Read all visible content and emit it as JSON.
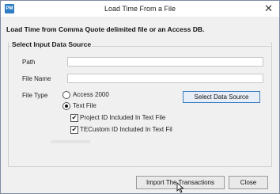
{
  "window": {
    "title": "Load Time From a File",
    "icon_text": "PM",
    "close_glyph": "✕"
  },
  "dialog": {
    "heading": "Load Time from Comma Quote delimited file or an Access DB.",
    "group_title": "Select Input Data Source",
    "path_label": "Path",
    "path_value": "",
    "file_name_label": "File Name",
    "file_name_value": "",
    "file_type_label": "File Type",
    "file_types": [
      {
        "label": "Access 2000",
        "selected": false
      },
      {
        "label": "Text File",
        "selected": true
      }
    ],
    "options": [
      {
        "label": "Project ID Included In Text File",
        "checked": true
      },
      {
        "label": "TECustom ID Included In Text Fil",
        "checked": true
      }
    ],
    "select_source_button": "Select Data Source",
    "import_button": "Import The Transactions",
    "close_button": "Close"
  },
  "colors": {
    "accent": "#2f7dc4",
    "background": "#f0f0f0"
  },
  "icons": {
    "app": "pm-app-icon",
    "close": "close-icon",
    "cursor": "mouse-pointer-icon"
  }
}
